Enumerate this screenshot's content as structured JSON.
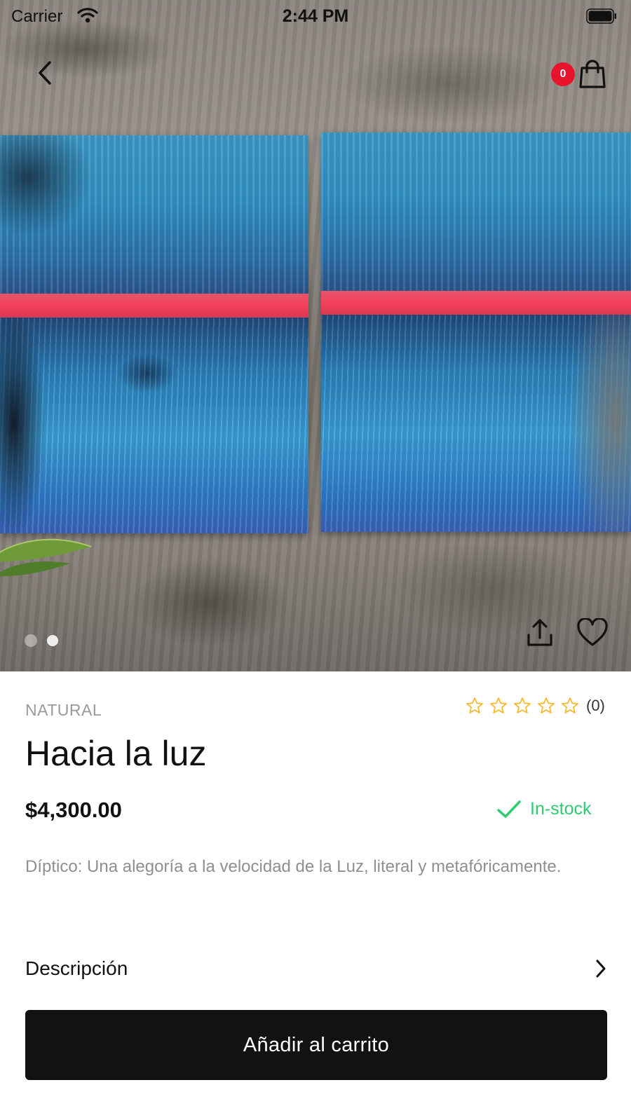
{
  "status_bar": {
    "carrier": "Carrier",
    "time": "2:44 PM",
    "icons": [
      "wifi-icon",
      "battery-icon"
    ]
  },
  "nav": {
    "back_icon": "chevron-left-icon",
    "cart_icon": "shopping-bag-icon",
    "cart_count": "0",
    "badge_color": "#e8142e"
  },
  "gallery": {
    "image_count": 2,
    "active_index": 1,
    "share_icon": "share-upload-icon",
    "favorite_icon": "heart-icon"
  },
  "product": {
    "category": "NATURAL",
    "name": "Hacia la luz",
    "price": "$4,300.00",
    "rating": {
      "stars_filled": 0,
      "stars_total": 5,
      "count_label": "(0)",
      "star_color": "#f5b82e"
    },
    "stock": {
      "label": "In-stock",
      "icon": "checkmark-icon",
      "color": "#2ecc71"
    },
    "short_description": "Díptico: Una alegoría a la velocidad de la Luz, literal y metafóricamente."
  },
  "details_row": {
    "label": "Descripción",
    "icon": "chevron-right-icon"
  },
  "actions": {
    "add_to_cart_label": "Añadir al carrito",
    "button_color": "#121212"
  }
}
